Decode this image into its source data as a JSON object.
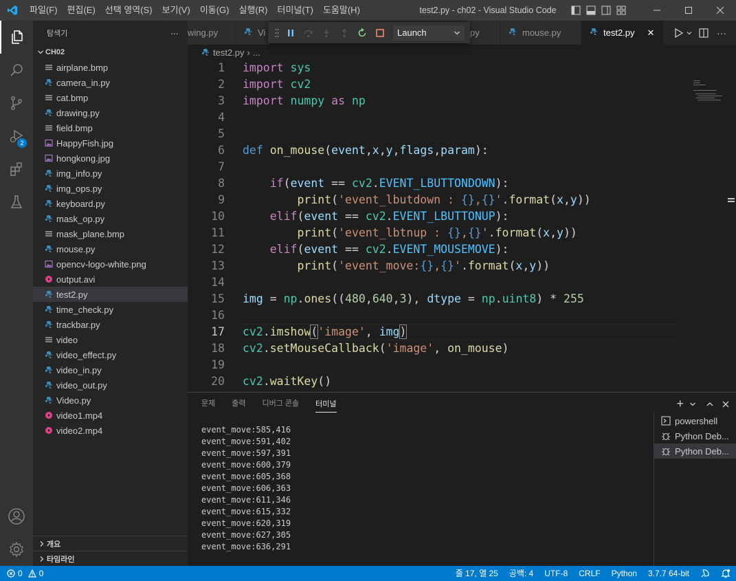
{
  "titlebar": {
    "menu": [
      "파일(F)",
      "편집(E)",
      "선택 영역(S)",
      "보기(V)",
      "이동(G)",
      "실행(R)",
      "터미널(T)",
      "도움말(H)"
    ],
    "title": "test2.py - ch02 - Visual Studio Code"
  },
  "activity": {
    "debug_badge": "2"
  },
  "sidebar": {
    "header": "탐색기",
    "more": "···",
    "folder": "CH02",
    "files": [
      {
        "name": "airplane.bmp",
        "icon": "lines"
      },
      {
        "name": "camera_in.py",
        "icon": "python"
      },
      {
        "name": "cat.bmp",
        "icon": "lines"
      },
      {
        "name": "drawing.py",
        "icon": "python"
      },
      {
        "name": "field.bmp",
        "icon": "lines"
      },
      {
        "name": "HappyFish.jpg",
        "icon": "image"
      },
      {
        "name": "hongkong.jpg",
        "icon": "image"
      },
      {
        "name": "img_info.py",
        "icon": "python"
      },
      {
        "name": "img_ops.py",
        "icon": "python"
      },
      {
        "name": "keyboard.py",
        "icon": "python"
      },
      {
        "name": "mask_op.py",
        "icon": "python"
      },
      {
        "name": "mask_plane.bmp",
        "icon": "lines"
      },
      {
        "name": "mouse.py",
        "icon": "python"
      },
      {
        "name": "opencv-logo-white.png",
        "icon": "image"
      },
      {
        "name": "output.avi",
        "icon": "video"
      },
      {
        "name": "test2.py",
        "icon": "python"
      },
      {
        "name": "time_check.py",
        "icon": "python"
      },
      {
        "name": "trackbar.py",
        "icon": "python"
      },
      {
        "name": "video",
        "icon": "lines"
      },
      {
        "name": "video_effect.py",
        "icon": "python"
      },
      {
        "name": "video_in.py",
        "icon": "python"
      },
      {
        "name": "video_out.py",
        "icon": "python"
      },
      {
        "name": "Video.py",
        "icon": "python"
      },
      {
        "name": "video1.mp4",
        "icon": "video"
      },
      {
        "name": "video2.mp4",
        "icon": "video"
      }
    ],
    "selected_file": "test2.py",
    "sections": [
      "개요",
      "타임라인"
    ]
  },
  "tabs": {
    "partial1": "wing.py",
    "partial2": "Vi",
    "partial3": "py",
    "mouse": "mouse.py",
    "active": "test2.py",
    "close": "✕"
  },
  "debug": {
    "config": "Launch"
  },
  "breadcrumb": {
    "file": "test2.py",
    "sep": "›",
    "more": "..."
  },
  "code": {
    "current_line": 17,
    "line_numbers": [
      "1",
      "2",
      "3",
      "4",
      "5",
      "6",
      "7",
      "8",
      "9",
      "10",
      "11",
      "12",
      "13",
      "14",
      "15",
      "16",
      "17",
      "18",
      "19",
      "20"
    ]
  },
  "panel": {
    "tabs": [
      "문제",
      "출력",
      "디버그 콘솔",
      "터미널"
    ],
    "active_tab": "터미널",
    "terminal_lines": [
      "event_move:585,416",
      "event_move:591,402",
      "event_move:597,391",
      "event_move:600,379",
      "event_move:605,368",
      "event_move:606,363",
      "event_move:611,346",
      "event_move:615,332",
      "event_move:620,319",
      "event_move:627,305",
      "event_move:636,291"
    ],
    "terminal_list": [
      "powershell",
      "Python Deb...",
      "Python Deb..."
    ],
    "add_label": "+"
  },
  "status": {
    "errors": "0",
    "warnings": "0",
    "position": "줄 17, 열 25",
    "spaces": "공백: 4",
    "encoding": "UTF-8",
    "eol": "CRLF",
    "language": "Python",
    "interpreter": "3.7.7 64-bit"
  },
  "colors": {
    "statusbar": "#007acc",
    "titlebar": "#3c3c3c",
    "sidebar": "#252526",
    "editor": "#1e1e1e",
    "python_icon": "#3c8dbc",
    "image_icon": "#a074c4",
    "video_icon": "#e83e8c"
  }
}
